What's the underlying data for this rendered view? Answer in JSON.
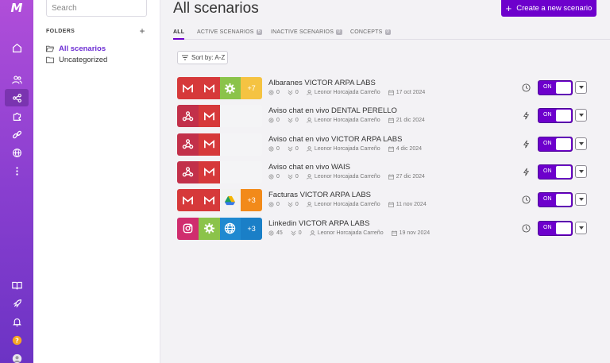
{
  "rail": {
    "logo": "M",
    "icons": [
      "home-icon",
      "users-icon",
      "share-icon",
      "puzzle-icon",
      "link-icon",
      "globe-icon",
      "more-dots-icon",
      "book-icon",
      "rocket-icon",
      "bell-icon",
      "help-icon",
      "avatar"
    ]
  },
  "folders": {
    "search_placeholder": "Search",
    "header": "FOLDERS",
    "add_label": "+",
    "items": [
      {
        "label": "All scenarios",
        "selected": true
      },
      {
        "label": "Uncategorized",
        "selected": false
      }
    ]
  },
  "main": {
    "title": "All scenarios",
    "create_button": "Create a new scenario",
    "create_plus": "+",
    "tabs": [
      {
        "label": "ALL",
        "badge": ""
      },
      {
        "label": "ACTIVE SCENARIOS",
        "badge": "6"
      },
      {
        "label": "INACTIVE SCENARIOS",
        "badge": "0"
      },
      {
        "label": "CONCEPTS",
        "badge": "0"
      }
    ],
    "sort_label": "Sort by: A-Z",
    "toggle_label": "ON",
    "scenarios": [
      {
        "name": "Albaranes VICTOR ARPA LABS",
        "ops": "0",
        "errors": "0",
        "owner": "Leonor Horcajada Carreño",
        "date": "17 oct 2024",
        "trigger": "clock",
        "modules": [
          "gmail",
          "gmail",
          "tools",
          "more-y"
        ],
        "more": "+7"
      },
      {
        "name": "Aviso chat en vivo DENTAL PERELLO",
        "ops": "0",
        "errors": "0",
        "owner": "Leonor Horcajada Carreño",
        "date": "21 dic 2024",
        "trigger": "bolt",
        "modules": [
          "webhook",
          "gmail",
          "empty",
          "empty"
        ],
        "more": ""
      },
      {
        "name": "Aviso chat en vivo VICTOR ARPA LABS",
        "ops": "0",
        "errors": "0",
        "owner": "Leonor Horcajada Carreño",
        "date": "4 dic 2024",
        "trigger": "bolt",
        "modules": [
          "webhook",
          "gmail",
          "empty",
          "empty"
        ],
        "more": ""
      },
      {
        "name": "Aviso chat en vivo WAIS",
        "ops": "0",
        "errors": "0",
        "owner": "Leonor Horcajada Carreño",
        "date": "27 dic 2024",
        "trigger": "bolt",
        "modules": [
          "webhook",
          "gmail",
          "empty",
          "empty"
        ],
        "more": ""
      },
      {
        "name": "Facturas VICTOR ARPA LABS",
        "ops": "0",
        "errors": "0",
        "owner": "Leonor Horcajada Carreño",
        "date": "11 nov 2024",
        "trigger": "clock",
        "modules": [
          "gmail",
          "gmail",
          "drive",
          "more-o"
        ],
        "more": "+3"
      },
      {
        "name": "Linkedin VICTOR ARPA LABS",
        "ops": "45",
        "errors": "0",
        "owner": "Leonor Horcajada Carreño",
        "date": "19 nov 2024",
        "trigger": "clock",
        "modules": [
          "insta",
          "tools",
          "http",
          "more-b"
        ],
        "more": "+3"
      }
    ]
  },
  "colors": {
    "accent": "#6d00cc",
    "rail_top": "#b04ed9",
    "rail_bottom": "#6c33c4",
    "gmail": "#d6393a",
    "webhook": "#c2304a",
    "tools": "#8bc34a",
    "instagram": "#d02d6e",
    "http": "#1f89d0"
  }
}
